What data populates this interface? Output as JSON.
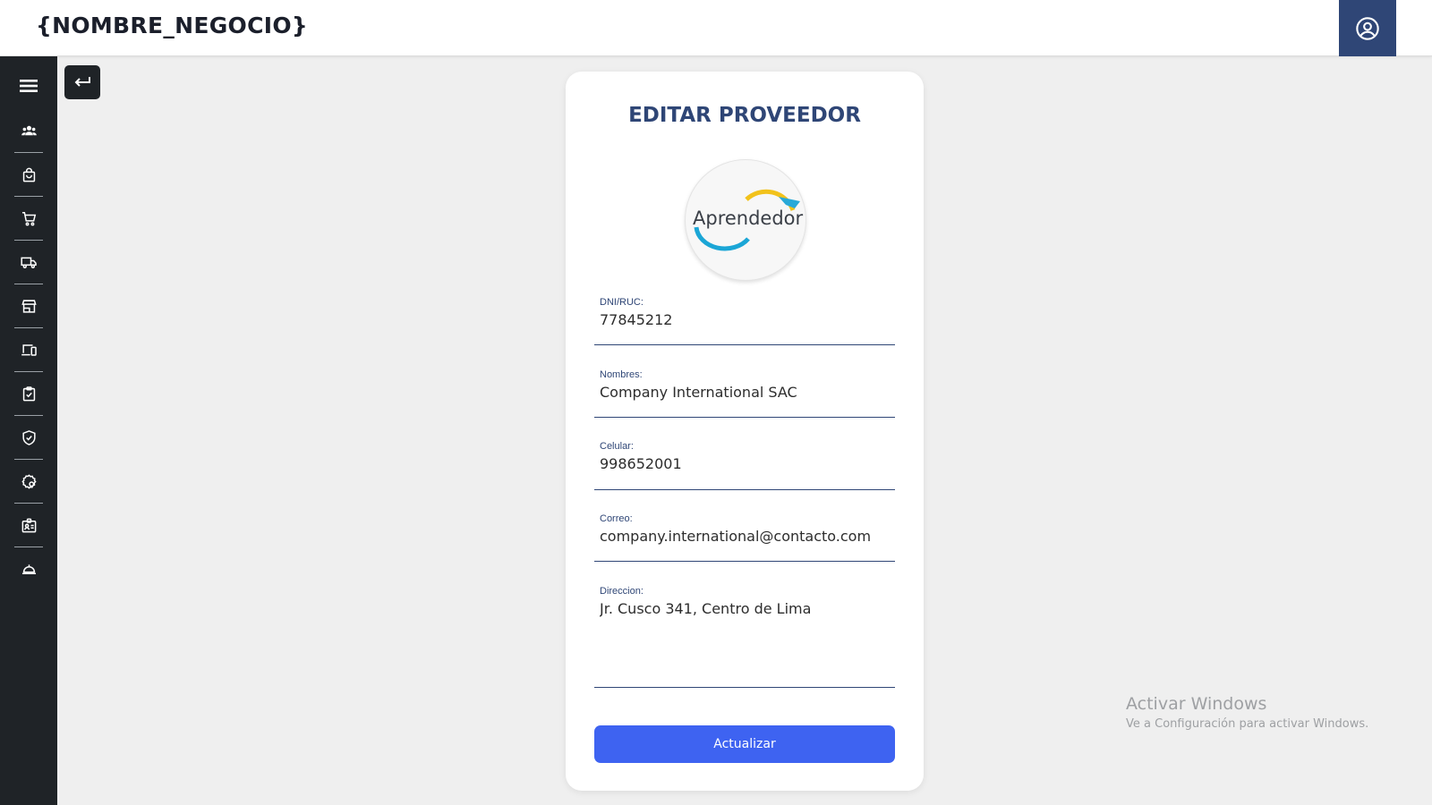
{
  "app": {
    "brand": "{NOMBRE_NEGOCIO}",
    "accent": "#2f4676",
    "button_color": "#3e63f1"
  },
  "header": {
    "user_icon": "user-circle-icon"
  },
  "sidebar": {
    "items": [
      {
        "icon": "users-icon",
        "label": "Clientes"
      },
      {
        "icon": "shopping-bag-icon",
        "label": "Productos"
      },
      {
        "icon": "shopping-cart-icon",
        "label": "Ventas"
      },
      {
        "icon": "truck-icon",
        "label": "Proveedores"
      },
      {
        "icon": "store-icon",
        "label": "Tienda"
      },
      {
        "icon": "devices-icon",
        "label": "Dispositivos"
      },
      {
        "icon": "clipboard-check-icon",
        "label": "Inventario"
      },
      {
        "icon": "shield-check-icon",
        "label": "Seguridad"
      },
      {
        "icon": "badge-settings-icon",
        "label": "Configuración"
      },
      {
        "icon": "id-card-icon",
        "label": "Empleados"
      },
      {
        "icon": "room-service-icon",
        "label": "Servicios"
      }
    ]
  },
  "form": {
    "title": "EDITAR PROVEEDOR",
    "logo_text": "Aprendedor",
    "fields": {
      "dni": {
        "label": "DNI/RUC:",
        "value": "77845212"
      },
      "nombres": {
        "label": "Nombres:",
        "value": "Company International SAC"
      },
      "celular": {
        "label": "Celular:",
        "value": "998652001"
      },
      "correo": {
        "label": "Correo:",
        "value": "company.international@contacto.com"
      },
      "direccion": {
        "label": "Direccion:",
        "value": "Jr. Cusco 341, Centro de Lima"
      }
    },
    "submit_label": "Actualizar"
  },
  "watermark": {
    "title": "Activar Windows",
    "subtitle": "Ve a Configuración para activar Windows."
  }
}
